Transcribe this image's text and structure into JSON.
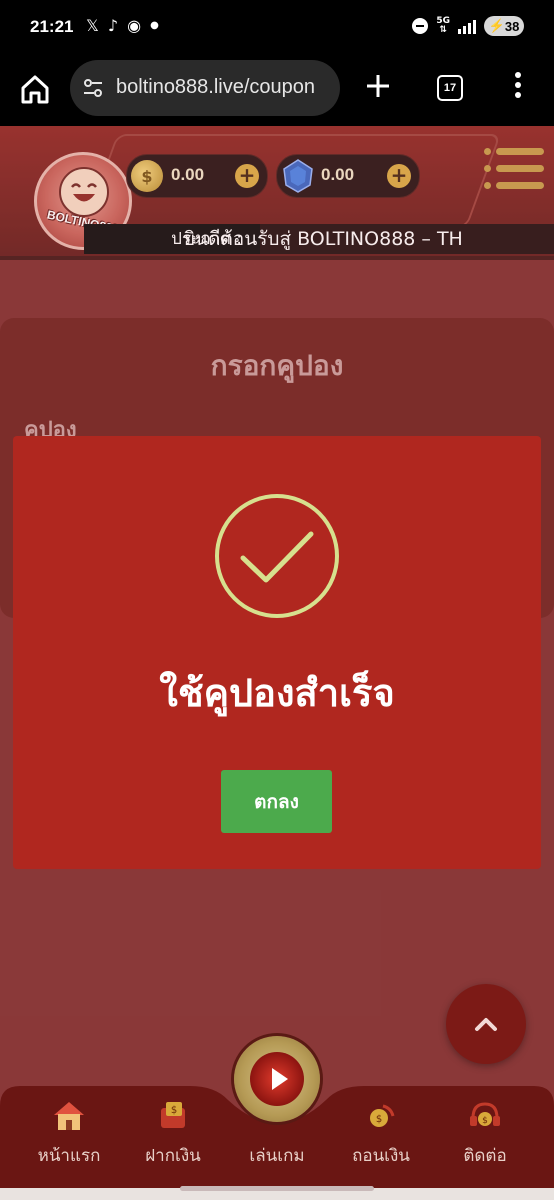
{
  "status_bar": {
    "time": "21:21",
    "left_icons": [
      "x-icon",
      "tiktok-icon",
      "recorder-icon",
      "dot"
    ],
    "network": "5G",
    "battery": "38"
  },
  "browser": {
    "url": "boltino888.live/coupon",
    "tab_count": "17"
  },
  "header": {
    "logo_text": "BOLTINO888",
    "coins_balance": "0.00",
    "gems_balance": "0.00",
    "announce_label": "ประกาศ :",
    "announce_text": "ยินดีต้อนรับสู่ BOLTINO888 – TH"
  },
  "coupon_form": {
    "title": "กรอกคูปอง",
    "field_label": "คูปอง"
  },
  "dialog": {
    "message": "ใช้คูปองสำเร็จ",
    "ok_label": "ตกลง"
  },
  "nav": {
    "items": [
      {
        "label": "หน้าแรก",
        "icon": "home-icon"
      },
      {
        "label": "ฝากเงิน",
        "icon": "deposit-icon"
      },
      {
        "label": "เล่นเกม",
        "icon": "play-icon"
      },
      {
        "label": "ถอนเงิน",
        "icon": "withdraw-icon"
      },
      {
        "label": "ติดต่อ",
        "icon": "contact-icon"
      }
    ]
  },
  "colors": {
    "dialog_bg": "#b0271f",
    "ok_button": "#4caa4c",
    "check": "#d7e08e"
  }
}
